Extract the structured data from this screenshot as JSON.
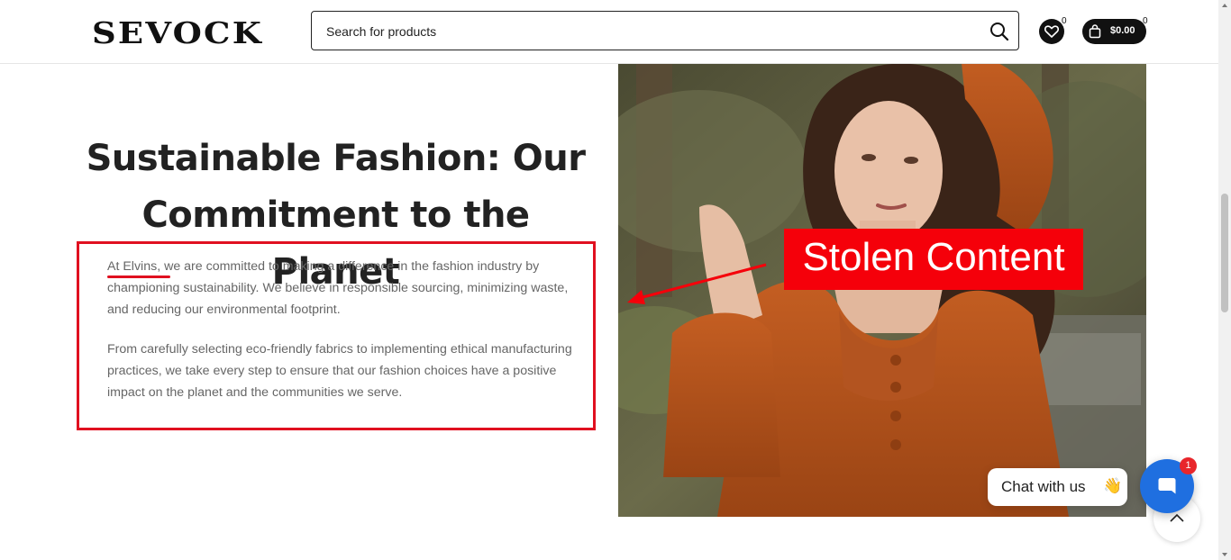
{
  "header": {
    "logo": "SEVOCK",
    "search_placeholder": "Search for products",
    "wishlist_count": "0",
    "cart_total": "$0.00",
    "cart_count": "0"
  },
  "main": {
    "headline": "Sustainable Fashion: Our Commitment to the Planet",
    "paragraph1": "At Elvins, we are committed to making a difference in the fashion industry by championing sustainability. We believe in responsible sourcing, minimizing waste, and reducing our environmental footprint.",
    "paragraph2": "From carefully selecting eco-friendly fabrics to implementing ethical manufacturing practices, we take every step to ensure that our fashion choices have a positive impact on the planet and the communities we serve."
  },
  "annotation": {
    "label": "Stolen Content",
    "color": "#f5000a"
  },
  "chat": {
    "label": "Chat with us",
    "emoji": "👋",
    "badge": "1"
  },
  "icons": [
    "search-icon",
    "heart-icon",
    "shopping-bag-icon",
    "chat-icon",
    "chevron-up-icon"
  ],
  "colors": {
    "accent_red": "#e01020",
    "chat_blue": "#1f6fe0",
    "dress_orange": "#b8521c"
  }
}
